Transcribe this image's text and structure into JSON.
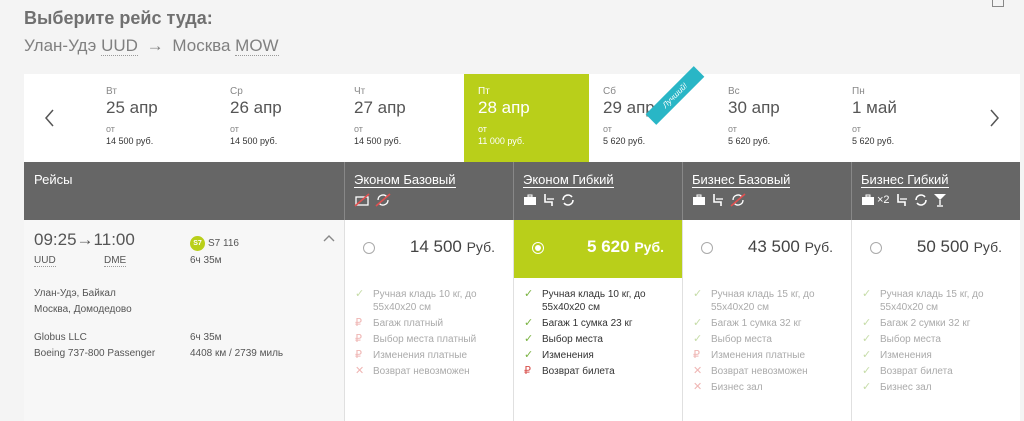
{
  "header": {
    "title": "Выберите рейс туда:",
    "origin_city": "Улан-Удэ",
    "origin_code": "UUD",
    "arrow": "→",
    "dest_city": "Москва",
    "dest_code": "MOW"
  },
  "dates": [
    {
      "dow": "Вт",
      "date": "25 апр",
      "from": "от",
      "price": "14 500 руб.",
      "active": false
    },
    {
      "dow": "Ср",
      "date": "26 апр",
      "from": "от",
      "price": "14 500 руб.",
      "active": false
    },
    {
      "dow": "Чт",
      "date": "27 апр",
      "from": "от",
      "price": "14 500 руб.",
      "active": false
    },
    {
      "dow": "Пт",
      "date": "28 апр",
      "from": "от",
      "price": "11 000 руб.",
      "active": true
    },
    {
      "dow": "Сб",
      "date": "29 апр",
      "from": "от",
      "price": "5 620 руб.",
      "active": false
    },
    {
      "dow": "Вс",
      "date": "30 апр",
      "from": "от",
      "price": "5 620 руб.",
      "active": false
    },
    {
      "dow": "Пн",
      "date": "1 май",
      "from": "от",
      "price": "5 620 руб.",
      "active": false
    }
  ],
  "table_header": {
    "flights": "Рейсы",
    "fares": [
      {
        "name": "Эконом Базовый",
        "icons": "⊘ ⊘"
      },
      {
        "name": "Эконом Гибкий",
        "icons": "▣ ⌐ ↻"
      },
      {
        "name": "Бизнес Базовый",
        "icons": "▣ ⌐ ⊘"
      },
      {
        "name": "Бизнес Гибкий",
        "icons": "▣×2 ⌐ ↻ Y"
      }
    ],
    "best_badge": "Лучший!"
  },
  "flight": {
    "dep_time": "09:25",
    "arr_time": "11:00",
    "arrow": "→",
    "dep_code": "UUD",
    "arr_code": "DME",
    "airline_logo": "S7",
    "flight_no": "S7 116",
    "duration": "6ч 35м",
    "origin_airport": "Улан-Удэ, Байкал",
    "dest_airport": "Москва, Домодедово",
    "operator": "Globus LLC",
    "aircraft": "Boeing 737-800 Passenger",
    "duration2": "6ч 35м",
    "distance": "4408 км / 2739 миль",
    "chevron": "^"
  },
  "fares": [
    {
      "price": "14 500",
      "currency": "Руб.",
      "selected": false,
      "features": [
        {
          "status": "ok",
          "icon": "✓",
          "text": "Ручная кладь 10 кг, до 55х40х20 см"
        },
        {
          "status": "paid",
          "icon": "₽",
          "text": "Багаж платный"
        },
        {
          "status": "paid",
          "icon": "₽",
          "text": "Выбор места платный"
        },
        {
          "status": "paid",
          "icon": "₽",
          "text": "Изменения платные"
        },
        {
          "status": "no",
          "icon": "✕",
          "text": "Возврат невозможен"
        }
      ]
    },
    {
      "price": "5 620",
      "currency": "Руб.",
      "selected": true,
      "features": [
        {
          "status": "ok",
          "icon": "✓",
          "text": "Ручная кладь 10 кг, до 55х40х20 см"
        },
        {
          "status": "ok",
          "icon": "✓",
          "text": "Багаж 1 сумка 23 кг"
        },
        {
          "status": "ok",
          "icon": "✓",
          "text": "Выбор места"
        },
        {
          "status": "ok",
          "icon": "✓",
          "text": "Изменения"
        },
        {
          "status": "paid",
          "icon": "₽",
          "text": "Возврат билета"
        }
      ]
    },
    {
      "price": "43 500",
      "currency": "Руб.",
      "selected": false,
      "features": [
        {
          "status": "ok",
          "icon": "✓",
          "text": "Ручная кладь 15 кг, до 55х40х20 см"
        },
        {
          "status": "ok",
          "icon": "✓",
          "text": "Багаж 1 сумка 32 кг"
        },
        {
          "status": "ok",
          "icon": "✓",
          "text": "Выбор места"
        },
        {
          "status": "paid",
          "icon": "₽",
          "text": "Изменения платные"
        },
        {
          "status": "no",
          "icon": "✕",
          "text": "Возврат невозможен"
        },
        {
          "status": "no",
          "icon": "✕",
          "text": "Бизнес зал"
        }
      ]
    },
    {
      "price": "50 500",
      "currency": "Руб.",
      "selected": false,
      "features": [
        {
          "status": "ok",
          "icon": "✓",
          "text": "Ручная кладь 15 кг, до 55х40х20 см"
        },
        {
          "status": "ok",
          "icon": "✓",
          "text": "Багаж 2 сумки 32 кг"
        },
        {
          "status": "ok",
          "icon": "✓",
          "text": "Выбор места"
        },
        {
          "status": "ok",
          "icon": "✓",
          "text": "Изменения"
        },
        {
          "status": "ok",
          "icon": "✓",
          "text": "Возврат билета"
        },
        {
          "status": "ok",
          "icon": "✓",
          "text": "Бизнес зал"
        }
      ]
    }
  ],
  "colors": {
    "accent": "#b9cf1a",
    "header_bg": "#666666",
    "ribbon": "#29b6c6",
    "ok": "#7ab342",
    "bad": "#d9534f"
  }
}
